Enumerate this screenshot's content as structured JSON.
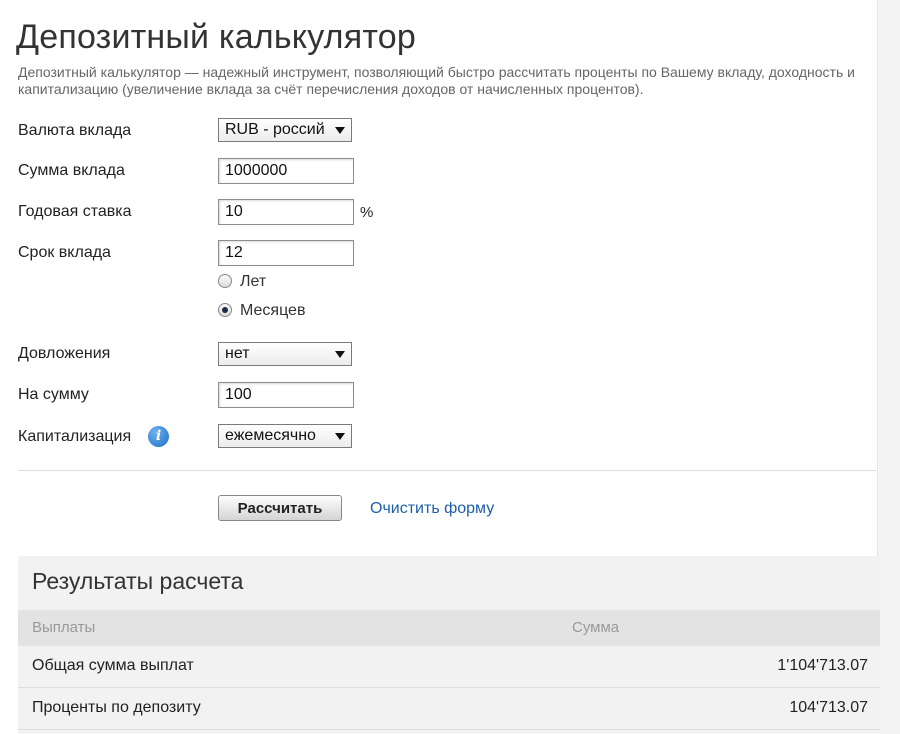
{
  "page": {
    "title": "Депозитный калькулятор",
    "intro": "Депозитный калькулятор — надежный инструмент, позволяющий быстро рассчитать проценты по Вашему вкладу, доходность и капитализацию (увеличение вклада за счёт перечисления доходов от начисленных процентов)."
  },
  "form": {
    "currency": {
      "label": "Валюта вклада",
      "value": "RUB - россий"
    },
    "amount": {
      "label": "Сумма вклада",
      "value": "1000000"
    },
    "rate": {
      "label": "Годовая ставка",
      "value": "10",
      "unit": "%"
    },
    "term": {
      "label": "Срок вклада",
      "value": "12",
      "options": [
        {
          "label": "Лет",
          "checked": false
        },
        {
          "label": "Месяцев",
          "checked": true
        }
      ]
    },
    "additions": {
      "label": "Довложения",
      "value": "нет"
    },
    "addition_amount": {
      "label": "На сумму",
      "value": "100"
    },
    "capitalization": {
      "label": "Капитализация",
      "value": "ежемесячно",
      "info_icon": "info-icon"
    }
  },
  "actions": {
    "calculate_label": "Рассчитать",
    "clear_label": "Очистить форму"
  },
  "results": {
    "title": "Результаты расчета",
    "columns": [
      "Выплаты",
      "Сумма"
    ],
    "rows": [
      {
        "name": "Общая сумма выплат",
        "value": "1'104'713.07"
      },
      {
        "name": "Проценты по депозиту",
        "value": "104'713.07"
      }
    ]
  },
  "colors": {
    "link": "#1f5fa6",
    "info_icon": "#1b6fc4",
    "results_bg": "#f2f2f2"
  }
}
